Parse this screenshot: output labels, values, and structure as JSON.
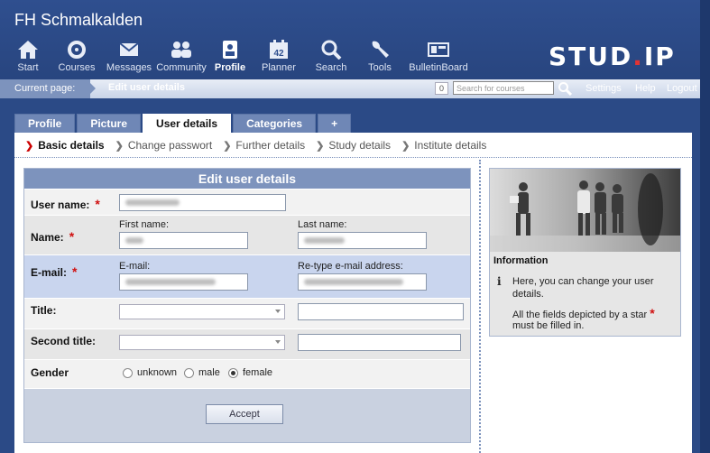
{
  "header": {
    "site_name": "FH Schmalkalden",
    "logo_left": "STUD",
    "logo_dot": ".",
    "logo_right": "IP",
    "nav": [
      {
        "label": "Start",
        "icon": "home-icon"
      },
      {
        "label": "Courses",
        "icon": "courses-icon"
      },
      {
        "label": "Messages",
        "icon": "envelope-icon"
      },
      {
        "label": "Community",
        "icon": "people-icon"
      },
      {
        "label": "Profile",
        "icon": "profile-icon",
        "active": true
      },
      {
        "label": "Planner",
        "icon": "calendar-icon",
        "badge": "42"
      },
      {
        "label": "Search",
        "icon": "search-icon"
      },
      {
        "label": "Tools",
        "icon": "wrench-icon"
      },
      {
        "label": "BulletinBoard",
        "icon": "bulletin-icon"
      }
    ]
  },
  "crumbbar": {
    "label": "Current page:",
    "page": "Edit user details",
    "count": "0",
    "search_placeholder": "Search for courses",
    "links": [
      "Settings",
      "Help",
      "Logout"
    ]
  },
  "tabs": [
    "Profile",
    "Picture",
    "User details",
    "Categories",
    "+"
  ],
  "subnav": [
    "Basic details",
    "Change passwort",
    "Further details",
    "Study details",
    "Institute details"
  ],
  "form": {
    "caption": "Edit user details",
    "username_label": "User name:",
    "name_label": "Name:",
    "first_name_label": "First name:",
    "last_name_label": "Last name:",
    "email_label": "E-mail:",
    "email_sub_label": "E-mail:",
    "retype_label": "Re-type e-mail address:",
    "title_label": "Title:",
    "second_title_label": "Second title:",
    "gender_label": "Gender",
    "gender_options": [
      "unknown",
      "male",
      "female"
    ],
    "gender_selected": "female",
    "required_mark": "*",
    "accept": "Accept"
  },
  "info": {
    "title": "Information",
    "icon_glyph": "i",
    "line1": "Here, you can change your user",
    "line2": "details.",
    "line3": "All the fields depicted by a star",
    "line4": "must be filled in.",
    "star": "*"
  },
  "colors": {
    "header_bg": "#2f4f8f",
    "accent": "#7d93bd",
    "required": "#d01010",
    "highlight_row": "#c9d5ee"
  }
}
